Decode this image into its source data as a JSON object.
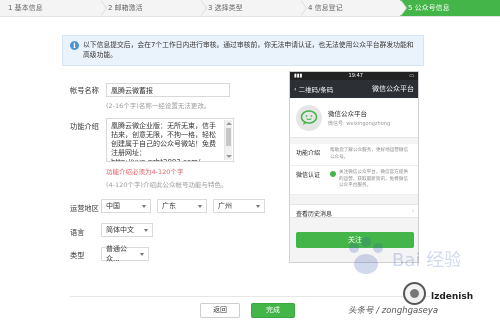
{
  "steps": [
    {
      "label": "1 基本信息"
    },
    {
      "label": "2 邮箱激活"
    },
    {
      "label": "3 选择类型"
    },
    {
      "label": "4 信息登记"
    },
    {
      "label": "5 公众号信息"
    }
  ],
  "notice": {
    "text": "以下信息提交后，会在7个工作日内进行审核。通过审核前，你无法申请认证，也无法使用公众平台群发功能和高级功能。"
  },
  "form": {
    "account_name": {
      "label": "帐号名称",
      "value": "凰腾云微蓄报",
      "hint": "(2-16个字)名称一经设置无法更改。"
    },
    "intro": {
      "label": "功能介绍",
      "value": "凰腾云微企业版：无所无束，信手拈来，创意无限，不拘一格，轻松创建属于自己的公众号微站！免费注册网址：http://yun.gzht2003.com/",
      "error": "功能介绍必须为4-120个字",
      "hint": "(4-120个字)介绍此公众帐号功能与特色。"
    },
    "region": {
      "label": "运营地区",
      "country": "中国",
      "province": "广东",
      "city": "广州"
    },
    "language": {
      "label": "语言",
      "value": "简体中文"
    },
    "type": {
      "label": "类型",
      "value": "普通公众..."
    }
  },
  "preview": {
    "status_time": "19:47",
    "nav_back": "二维码/条码",
    "nav_title": "微信公众平台",
    "profile_name": "微信公众平台",
    "profile_id": "微信号: weixingongzhong",
    "intro_label": "功能介绍",
    "intro_text": "帮助您了解公众服务，更好地运营微信公众号。",
    "verify_label": "微信认证",
    "verify_text": "关注微信公众平台，微信官方提供的运营，获取最新资讯，免费微信公众平台服务。",
    "history_label": "查看历史消息",
    "follow_label": "关注"
  },
  "buttons": {
    "back": "返回",
    "done": "完成"
  },
  "watermark": {
    "name": "lzdenish",
    "source": "头条号 / zonghgaseya",
    "baidu": "Bai 经验"
  },
  "colors": {
    "accent": "#44b549",
    "error": "#e15f63",
    "info": "#4a90d9"
  }
}
